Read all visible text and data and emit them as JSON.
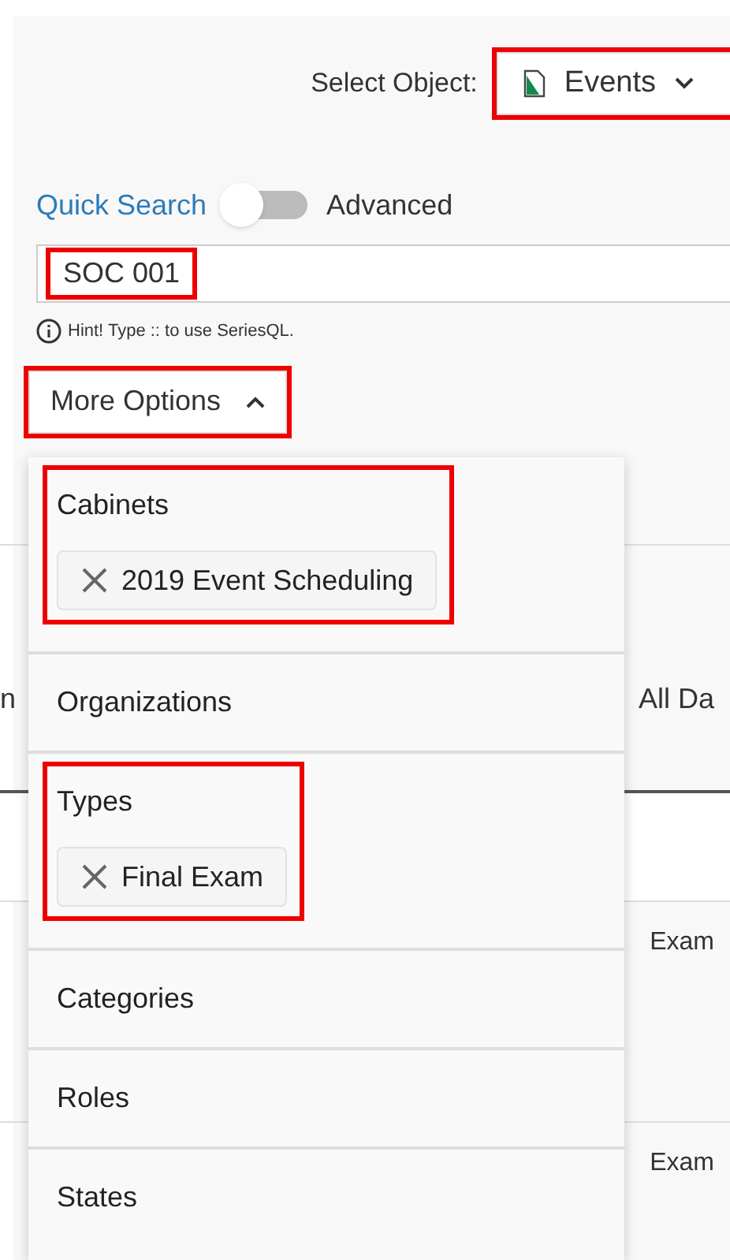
{
  "select_object": {
    "label": "Select Object:",
    "value": "Events",
    "highlighted": true
  },
  "search_mode": {
    "quick_label": "Quick Search",
    "advanced_label": "Advanced",
    "advanced": false
  },
  "search_field": {
    "value": "SOC 001",
    "highlighted": true
  },
  "hint": "Hint! Type :: to use SeriesQL.",
  "more_options": {
    "label": "More Options",
    "expanded": true,
    "highlighted": true
  },
  "filters": [
    {
      "label": "Cabinets",
      "chips": [
        "2019 Event Scheduling"
      ],
      "highlighted": true
    },
    {
      "label": "Organizations",
      "highlighted": false
    },
    {
      "label": "Types",
      "chips": [
        "Final Exam"
      ],
      "highlighted": true
    },
    {
      "label": "Categories",
      "highlighted": false
    },
    {
      "label": "Roles",
      "highlighted": false
    },
    {
      "label": "States",
      "highlighted": false
    }
  ],
  "background": {
    "toolbar_left": "n",
    "toolbar_right": "All Da",
    "cells": [
      "Exam",
      "Exam"
    ]
  }
}
